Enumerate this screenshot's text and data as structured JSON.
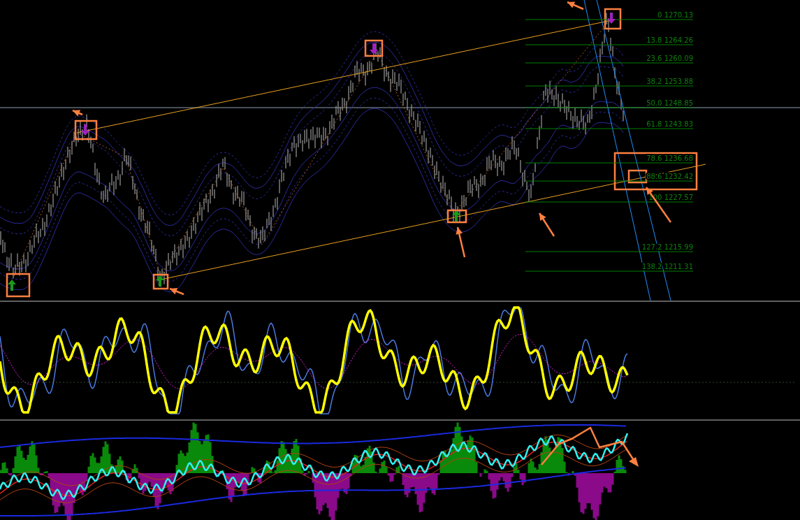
{
  "fibonacci_levels": [
    {
      "label": "0 1270.13"
    },
    {
      "label": "13.8 1264.26"
    },
    {
      "label": "23.6 1260.09"
    },
    {
      "label": "38.2 1253.88"
    },
    {
      "label": "50.0 1248.85"
    },
    {
      "label": "61.8 1243.83"
    },
    {
      "label": "78.6 1236.68"
    },
    {
      "label": "88.6 1232.42"
    },
    {
      "label": "100 1227.57"
    },
    {
      "label": "127.2 1215.99"
    },
    {
      "label": "138.2 1211.31"
    }
  ]
}
